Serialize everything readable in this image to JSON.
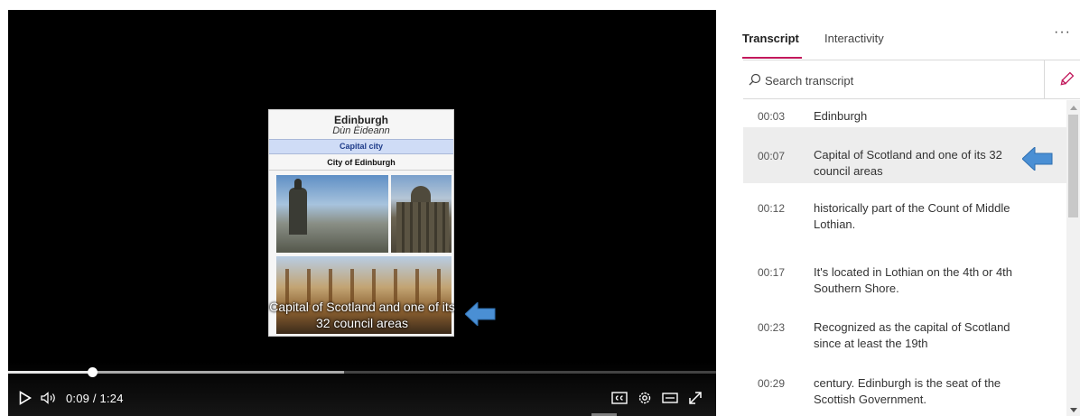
{
  "player": {
    "slide": {
      "title": "Edinburgh",
      "subtitle": "Dùn Èideann",
      "capital_label": "Capital city",
      "city_label": "City of Edinburgh"
    },
    "caption": "Capital of Scotland and one of its 32 council areas",
    "current_time": "0:09",
    "time_separator": "/",
    "duration": "1:24",
    "progress_played": 0.118,
    "progress_buffered": 0.475,
    "icons": {
      "play": "play-icon",
      "volume": "volume-icon",
      "captions": "closed-captions-icon",
      "settings": "gear-icon",
      "wide": "wide-mode-icon",
      "fullscreen": "fullscreen-icon",
      "annotation": "arrow-left-icon"
    }
  },
  "panel": {
    "tabs": [
      {
        "label": "Transcript",
        "active": true
      },
      {
        "label": "Interactivity",
        "active": false
      }
    ],
    "more_label": "···",
    "search": {
      "placeholder": "Search transcript"
    },
    "entries": [
      {
        "time": "00:03",
        "text": "Edinburgh"
      },
      {
        "time": "00:07",
        "text": "Capital of Scotland and one of its 32 council areas",
        "active": true
      },
      {
        "time": "00:12",
        "text": "historically part of the Count of Middle Lothian."
      },
      {
        "time": "00:17",
        "text": "It's located in Lothian on the 4th or 4th Southern Shore."
      },
      {
        "time": "00:23",
        "text": "Recognized as the capital of Scotland since at least the 19th"
      },
      {
        "time": "00:29",
        "text": "century. Edinburgh is the seat of the Scottish Government."
      }
    ]
  },
  "colors": {
    "accent": "#c2185b",
    "annotation_arrow": "#4a8fd4",
    "active_row": "#ededed"
  }
}
